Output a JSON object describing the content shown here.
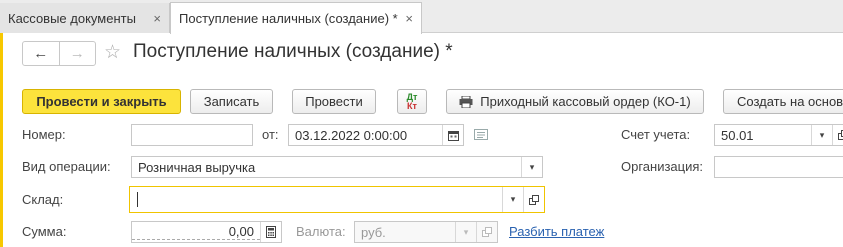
{
  "tabs": [
    {
      "label": "Кассовые документы",
      "close": "×"
    },
    {
      "label": "Поступление наличных (создание) *",
      "close": "×"
    }
  ],
  "nav": {
    "back": "←",
    "forward": "→"
  },
  "window_title": "Поступление наличных (создание) *",
  "toolbar": {
    "post_and_close": "Провести и закрыть",
    "save": "Записать",
    "post": "Провести",
    "dtkt_top": "Дт",
    "dtkt_bottom": "Кт",
    "print_order": "Приходный кассовый ордер (КО-1)",
    "create_based_on": "Создать на основ"
  },
  "form": {
    "number_label": "Номер:",
    "number_value": "",
    "date_label": "от:",
    "date_value": "03.12.2022  0:00:00",
    "account_label": "Счет учета:",
    "account_value": "50.01",
    "operation_label": "Вид операции:",
    "operation_value": "Розничная выручка",
    "organization_label": "Организация:",
    "organization_value": "",
    "warehouse_label": "Склад:",
    "warehouse_value": "",
    "amount_label": "Сумма:",
    "amount_value": "0,00",
    "currency_label": "Валюта:",
    "currency_value": "руб.",
    "split_payment_link": "Разбить платеж"
  },
  "colors": {
    "primary_button": "#fce33c",
    "focus_border": "#f0c400",
    "link": "#2a62b0",
    "side_accent": "#f7c800"
  }
}
